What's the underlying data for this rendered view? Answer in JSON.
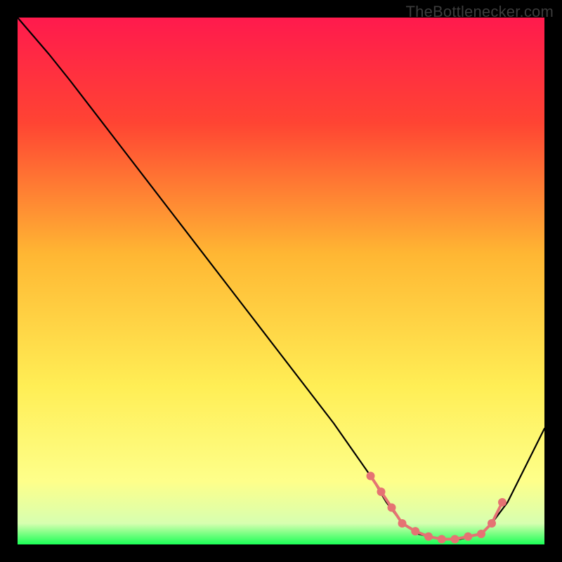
{
  "watermark": "TheBottlenecker.com",
  "chart_data": {
    "type": "line",
    "title": "",
    "xlabel": "",
    "ylabel": "",
    "xlim": [
      0,
      100
    ],
    "ylim": [
      0,
      100
    ],
    "gradient_stops": [
      {
        "offset": 0,
        "color": "#ff1a4d"
      },
      {
        "offset": 20,
        "color": "#ff4433"
      },
      {
        "offset": 45,
        "color": "#ffb733"
      },
      {
        "offset": 70,
        "color": "#ffee55"
      },
      {
        "offset": 88,
        "color": "#feff8a"
      },
      {
        "offset": 96,
        "color": "#d7ffb0"
      },
      {
        "offset": 100,
        "color": "#1aff55"
      }
    ],
    "series": [
      {
        "name": "bottleneck-curve",
        "x": [
          0,
          6,
          10,
          20,
          30,
          40,
          50,
          60,
          67,
          70,
          73,
          76,
          80,
          84,
          88,
          90,
          93,
          100
        ],
        "y": [
          100,
          93,
          88,
          75,
          62,
          49,
          36,
          23,
          13,
          8,
          4,
          2,
          1,
          1,
          2,
          4,
          8,
          22
        ]
      }
    ],
    "markers": {
      "name": "highlighted-points",
      "color": "#e57373",
      "radius": 6,
      "x": [
        67,
        69,
        71,
        73,
        75.5,
        78,
        80.5,
        83,
        85.5,
        88,
        90,
        92
      ],
      "y": [
        13,
        10,
        7,
        4,
        2.5,
        1.5,
        1,
        1,
        1.5,
        2,
        4,
        8
      ]
    }
  }
}
